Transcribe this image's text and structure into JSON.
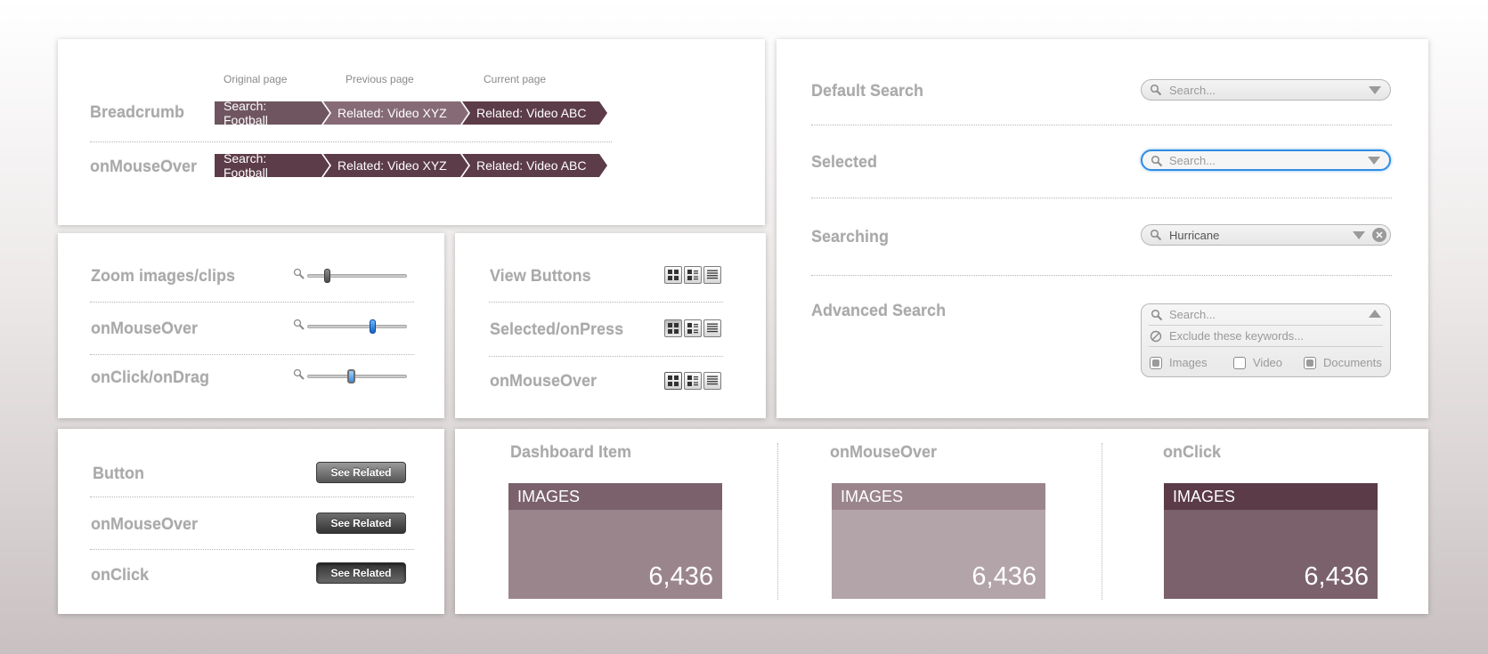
{
  "breadcrumb_panel": {
    "col_headers": [
      "Original page",
      "Previous page",
      "Current page"
    ],
    "rows": [
      {
        "label": "Breadcrumb",
        "items": [
          "Search: Football",
          "Related: Video XYZ",
          "Related: Video ABC"
        ]
      },
      {
        "label": "onMouseOver",
        "items": [
          "Search: Football",
          "Related: Video XYZ",
          "Related: Video ABC"
        ]
      }
    ],
    "colors": {
      "default": [
        "#6e5560",
        "#866b76",
        "#5c3c48"
      ],
      "hover": [
        "#5c3c48",
        "#5c3c48",
        "#5c3c48"
      ]
    }
  },
  "zoom_panel": {
    "rows": [
      {
        "label": "Zoom images/clips",
        "level": 0.2
      },
      {
        "label": "onMouseOver",
        "level": 0.65
      },
      {
        "label": "onClick/onDrag",
        "level": 0.43
      }
    ]
  },
  "view_panel": {
    "rows": [
      {
        "label": "View Buttons"
      },
      {
        "label": "Selected/onPress"
      },
      {
        "label": "onMouseOver"
      }
    ],
    "icons": [
      "grid-view-icon",
      "detail-view-icon",
      "list-view-icon"
    ]
  },
  "button_panel": {
    "rows": [
      {
        "label": "Button",
        "button": "See Related"
      },
      {
        "label": "onMouseOver",
        "button": "See Related"
      },
      {
        "label": "onClick",
        "button": "See Related"
      }
    ]
  },
  "dashboard_panel": {
    "items": [
      {
        "label": "Dashboard Item",
        "title": "IMAGES",
        "count": "6,436",
        "header_color": "#7a616c",
        "body_color": "#9b858d"
      },
      {
        "label": "onMouseOver",
        "title": "IMAGES",
        "count": "6,436",
        "header_color": "#9b858d",
        "body_color": "#b3a4a9"
      },
      {
        "label": "onClick",
        "title": "IMAGES",
        "count": "6,436",
        "header_color": "#5b3b47",
        "body_color": "#7a616c"
      }
    ]
  },
  "search_panel": {
    "default": {
      "label": "Default Search",
      "placeholder": "Search..."
    },
    "selected": {
      "label": "Selected",
      "placeholder": "Search..."
    },
    "searching": {
      "label": "Searching",
      "value": "Hurricane"
    },
    "advanced": {
      "label": "Advanced Search",
      "placeholder": "Search...",
      "exclude_placeholder": "Exclude these keywords...",
      "options": [
        {
          "label": "Images",
          "checked": true
        },
        {
          "label": "Video",
          "checked": false
        },
        {
          "label": "Documents",
          "checked": true
        }
      ]
    },
    "accent_color": "#2f8de4"
  }
}
